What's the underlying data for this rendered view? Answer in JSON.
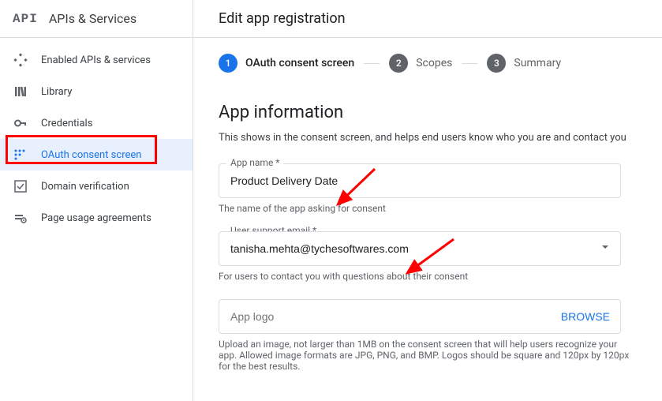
{
  "sidebar": {
    "title": "APIs & Services",
    "logo": "API",
    "items": [
      {
        "label": "Enabled APIs & services"
      },
      {
        "label": "Library"
      },
      {
        "label": "Credentials"
      },
      {
        "label": "OAuth consent screen"
      },
      {
        "label": "Domain verification"
      },
      {
        "label": "Page usage agreements"
      }
    ]
  },
  "header": {
    "title": "Edit app registration"
  },
  "stepper": {
    "steps": [
      {
        "num": "1",
        "label": "OAuth consent screen"
      },
      {
        "num": "2",
        "label": "Scopes"
      },
      {
        "num": "3",
        "label": "Summary"
      }
    ]
  },
  "section": {
    "title": "App information",
    "description": "This shows in the consent screen, and helps end users know who you are and contact you"
  },
  "fields": {
    "appName": {
      "label": "App name *",
      "value": "Product Delivery Date",
      "hint": "The name of the app asking for consent"
    },
    "supportEmail": {
      "label": "User support email *",
      "value": "tanisha.mehta@tychesoftwares.com",
      "hint": "For users to contact you with questions about their consent"
    },
    "appLogo": {
      "placeholder": "App logo",
      "browse": "BROWSE",
      "hint": "Upload an image, not larger than 1MB on the consent screen that will help users recognize your app. Allowed image formats are JPG, PNG, and BMP. Logos should be square and 120px by 120px for the best results."
    }
  }
}
